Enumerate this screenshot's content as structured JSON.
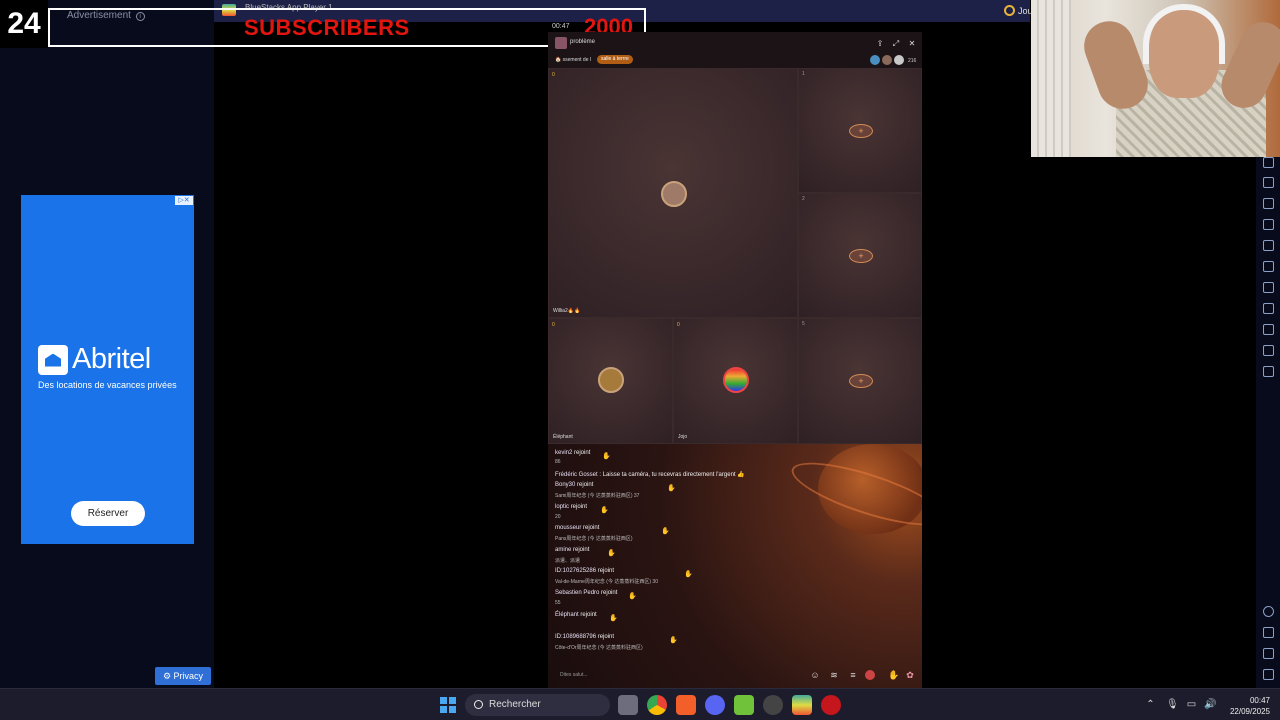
{
  "overlay": {
    "counter": "24",
    "subscribers_label": "SUBSCRIBERS",
    "subscribers_goal": "2000"
  },
  "ad": {
    "label": "Advertisement",
    "brand": "Abritel",
    "tagline": "Des locations de vacances privées",
    "cta": "Réserver",
    "privacy": "Privacy"
  },
  "app": {
    "title": "BlueStacks App Player 1",
    "right_label": "Jou"
  },
  "game": {
    "time": "00:47",
    "room_name": "problème",
    "announcement": "ssement de l",
    "room_tag": "salle à terrre",
    "viewer_count": "216",
    "seats": [
      {
        "idx": "",
        "num": "0",
        "name": "Willia2🔥🔥",
        "state": "occupied"
      },
      {
        "idx": "1",
        "num": "",
        "name": "",
        "state": "empty"
      },
      {
        "idx": "2",
        "num": "",
        "name": "",
        "state": "empty"
      },
      {
        "idx": "",
        "num": "0",
        "name": "Éléphant",
        "state": "occupied"
      },
      {
        "idx": "",
        "num": "0",
        "name": "Jojo",
        "state": "occupied"
      },
      {
        "idx": "5",
        "num": "",
        "name": "",
        "state": "empty"
      }
    ],
    "chat": [
      {
        "name": "kevin2",
        "text": "rejoint",
        "sub": "86"
      },
      {
        "name": "Frédéric Gosset",
        "text": ": Laisse ta caméra, tu recevras directement l'argent 👍",
        "sub": ""
      },
      {
        "name": "Bony30",
        "text": "rejoint",
        "sub": "Sami周年纪念  (今 达蒸蒸料驻西区)   37"
      },
      {
        "name": "loptic",
        "text": "rejoint",
        "sub": "20"
      },
      {
        "name": "mousseur",
        "text": "rejoint",
        "sub": "Pans周年纪念  (今 达蒸蒸料驻西区)"
      },
      {
        "name": "amine",
        "text": "rejoint",
        "sub": "派遣、派遣"
      },
      {
        "name": "ID:1027625286",
        "text": "rejoint",
        "sub": "Val-de-Marne周年纪念  (今 达蒸蒸料驻西区)   30"
      },
      {
        "name": "Sebastien Pedro",
        "text": "rejoint",
        "sub": "55"
      },
      {
        "name": "Éléphant",
        "text": "rejoint",
        "sub": ""
      },
      {
        "name": "ID:1089688796",
        "text": "rejoint",
        "sub": "Côte-d'Or周年纪念  (今 达蒸蒸料驻西区)"
      }
    ],
    "input_placeholder": "Dites salut..."
  },
  "taskbar": {
    "search": "Rechercher",
    "time": "00:47",
    "date": "22/09/2025"
  },
  "colors": {
    "ad_blue": "#1a73e8",
    "subscriber_red": "#e2150f",
    "taskbar": "#1c1c2c"
  }
}
